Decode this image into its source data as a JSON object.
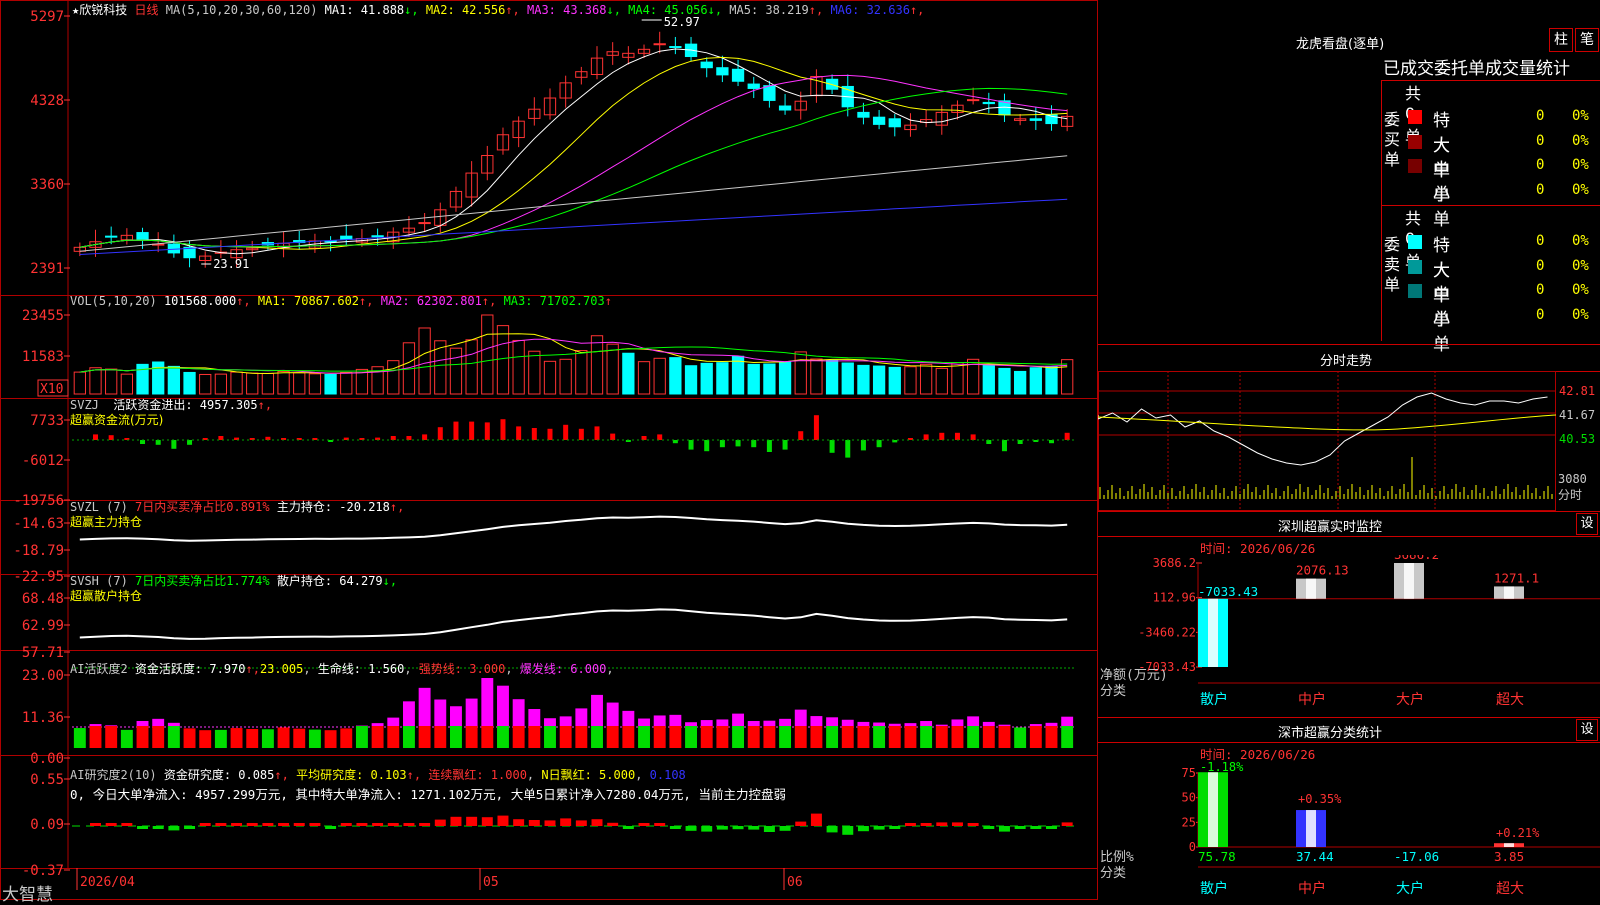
{
  "stock": {
    "title": "★欣锐科技",
    "period": "日线",
    "ma_params": "MA(5,10,20,30,60,120)",
    "ma_values": [
      {
        "label": "MA1: 41.888",
        "arrow": "↓",
        "color": "#ffffff"
      },
      {
        "label": "MA2: 42.556",
        "arrow": "↑",
        "color": "#ffff00"
      },
      {
        "label": "MA3: 43.368",
        "arrow": "↓",
        "color": "#ff33ff"
      },
      {
        "label": "MA4: 45.056",
        "arrow": "↓",
        "color": "#00ff00"
      },
      {
        "label": "MA5: 38.219",
        "arrow": "↑",
        "color": "#c8c8c8"
      },
      {
        "label": "MA6: 32.636",
        "arrow": "↑",
        "color": "#3333ff"
      }
    ],
    "y_ticks": [
      "5297",
      "4328",
      "3360",
      "2391"
    ],
    "high_label": "52.97",
    "low_label": "23.91",
    "date_labels": [
      "2026/04",
      "05",
      "06"
    ],
    "brand": "大智慧"
  },
  "volume": {
    "header": "VOL(5,10,20)",
    "value": "101568.000",
    "ma1": "MA1: 70867.602",
    "ma2": "MA2: 62302.801",
    "ma3": "MA3: 71702.703",
    "y_ticks": [
      "23455",
      "11583"
    ],
    "multiplier": "X10"
  },
  "svzj": {
    "header": "SVZJ",
    "label": "活跃资金进出: 4957.305",
    "subtitle": "超赢资金流(万元)",
    "y_ticks": [
      "7733",
      "-6012",
      "-19756"
    ]
  },
  "svzl": {
    "header": "SVZL (7)",
    "ratio": "7日内买卖净占比0.891%",
    "holding": "主力持仓: -20.218",
    "subtitle": "超赢主力持仓",
    "y_ticks": [
      "-14.63",
      "-18.79",
      "-22.95"
    ]
  },
  "svsh": {
    "header": "SVSH (7)",
    "ratio": "7日内买卖净占比1.774%",
    "holding": "散户持仓: 64.279",
    "subtitle": "超赢散户持仓",
    "y_ticks": [
      "68.48",
      "62.99",
      "57.71"
    ]
  },
  "ai_active": {
    "header": "AI活跃度2",
    "value": "资金活跃度: 7.970",
    "v2": "23.005",
    "life": "生命线: 1.560",
    "strong": "强势线: 3.000",
    "burst": "爆发线: 6.000",
    "y_ticks": [
      "23.00",
      "11.36",
      "0.00"
    ]
  },
  "ai_research": {
    "header": "AI研究度2(10)",
    "value": "资金研究度: 0.085",
    "avg": "平均研究度: 0.103",
    "red": "连续飘红: 1.000",
    "nred": "N日飘红: 5.000",
    "extra": "0.108",
    "summary": "0, 今日大单净流入: 4957.299万元, 其中特大单净流入: 1271.102万元, 大单5日累计净入7280.04万元, 当前主力控盘弱",
    "y_ticks": [
      "0.55",
      "0.09",
      "-0.37"
    ]
  },
  "dragon": {
    "title": "龙虎看盘(逐单)",
    "btn_bar": "柱",
    "btn_pen": "笔",
    "header": "已成交委托单成交量统计",
    "buy": {
      "side": "委买单",
      "total": "共 0单",
      "rows": [
        {
          "name": "特大",
          "count": "0",
          "pct": "0%",
          "color": "#ff0000"
        },
        {
          "name": "大单",
          "count": "0",
          "pct": "0%",
          "color": "#990000"
        },
        {
          "name": "中单",
          "count": "0",
          "pct": "0%",
          "color": "#770000"
        },
        {
          "name": "小单",
          "count": "0",
          "pct": "0%",
          "color": ""
        }
      ]
    },
    "sell": {
      "side": "委卖单",
      "total": "共 0单",
      "rows": [
        {
          "name": "特大",
          "count": "0",
          "pct": "0%",
          "color": "#00ffff"
        },
        {
          "name": "大单",
          "count": "0",
          "pct": "0%",
          "color": "#009999"
        },
        {
          "name": "中单",
          "count": "0",
          "pct": "0%",
          "color": "#007777"
        },
        {
          "name": "小单",
          "count": "0",
          "pct": "0%",
          "color": ""
        }
      ]
    }
  },
  "intraday": {
    "title": "分时走势",
    "y_ticks": [
      "42.81",
      "41.67",
      "40.53"
    ],
    "vol_label": "3080",
    "fen_label": "分时"
  },
  "sz_monitor": {
    "title": "深圳超赢实时监控",
    "set_label": "设",
    "time": "时间: 2026/06/26",
    "axis_title": "净额(万元)",
    "cat_label": "分类",
    "y_ticks": [
      "3686.2",
      "112.96",
      "-3460.22",
      "-7033.43"
    ],
    "categories": [
      "散户",
      "中户",
      "大户",
      "超大"
    ],
    "values": [
      -7033.43,
      2076.13,
      3686.2,
      1271.1
    ],
    "value_labels": [
      "-7033.43",
      "2076.13",
      "3686.2",
      "1271.1"
    ]
  },
  "sz_classify": {
    "title": "深市超赢分类统计",
    "set_label": "设",
    "time": "时间: 2026/06/26",
    "axis_title": "比例%",
    "cat_label": "分类",
    "y_ticks": [
      "75",
      "50",
      "25",
      "0"
    ],
    "categories": [
      "散户",
      "中户",
      "大户",
      "超大"
    ],
    "values": [
      75.78,
      37.44,
      -17.06,
      3.85
    ],
    "value_labels": [
      "75.78",
      "37.44",
      "-17.06",
      "3.85"
    ],
    "changes": [
      "-1.18%",
      "+0.35%",
      "",
      "+0.21%"
    ]
  },
  "chart_data": [
    {
      "type": "candlestick",
      "title": "欣锐科技 日线",
      "ylim": [
        23.91,
        52.97
      ],
      "x_labels": [
        "2026/04",
        "05",
        "06"
      ],
      "close": [
        26.5,
        27.2,
        27.8,
        28.0,
        27.5,
        26.9,
        25.8,
        25.2,
        25.4,
        25.9,
        26.2,
        26.4,
        26.8,
        27.0,
        27.1,
        27.3,
        27.2,
        27.5,
        27.6,
        27.9,
        28.4,
        28.9,
        29.6,
        31.2,
        33.5,
        35.8,
        38.0,
        40.6,
        42.3,
        43.8,
        45.2,
        47.1,
        48.5,
        50.2,
        51.0,
        50.8,
        51.3,
        52.0,
        51.6,
        50.4,
        49.0,
        48.1,
        47.3,
        46.4,
        44.9,
        43.7,
        44.8,
        47.9,
        46.3,
        44.1,
        42.8,
        41.9,
        41.6,
        41.8,
        42.5,
        43.4,
        44.3,
        45.0,
        44.5,
        43.1,
        42.6,
        42.4,
        42.0,
        42.9
      ],
      "volume": [
        6500,
        7800,
        7400,
        5900,
        8800,
        9500,
        8200,
        6400,
        5800,
        5900,
        6500,
        6200,
        6100,
        6700,
        6300,
        6000,
        5800,
        6400,
        7300,
        8100,
        9900,
        15200,
        19600,
        15800,
        13600,
        16100,
        23455,
        20300,
        15900,
        12700,
        9700,
        10300,
        12900,
        17300,
        14800,
        12100,
        9600,
        10600,
        10800,
        8400,
        9100,
        9300,
        11200,
        8800,
        8900,
        9500,
        12500,
        10400,
        10000,
        9200,
        8500,
        8300,
        7900,
        8100,
        8800,
        7600,
        9300,
        10300,
        8500,
        7600,
        6700,
        7800,
        8200,
        10200
      ]
    },
    {
      "type": "bar",
      "title": "深圳超赢实时监控",
      "categories": [
        "散户",
        "中户",
        "大户",
        "超大"
      ],
      "values": [
        -7033.43,
        2076.13,
        3686.2,
        1271.1
      ],
      "ylabel": "净额(万元)",
      "ylim": [
        -7033.43,
        3686.2
      ]
    },
    {
      "type": "bar",
      "title": "深市超赢分类统计",
      "categories": [
        "散户",
        "中户",
        "大户",
        "超大"
      ],
      "values": [
        75.78,
        37.44,
        -17.06,
        3.85
      ],
      "ylabel": "比例%",
      "ylim": [
        0,
        75
      ]
    }
  ]
}
